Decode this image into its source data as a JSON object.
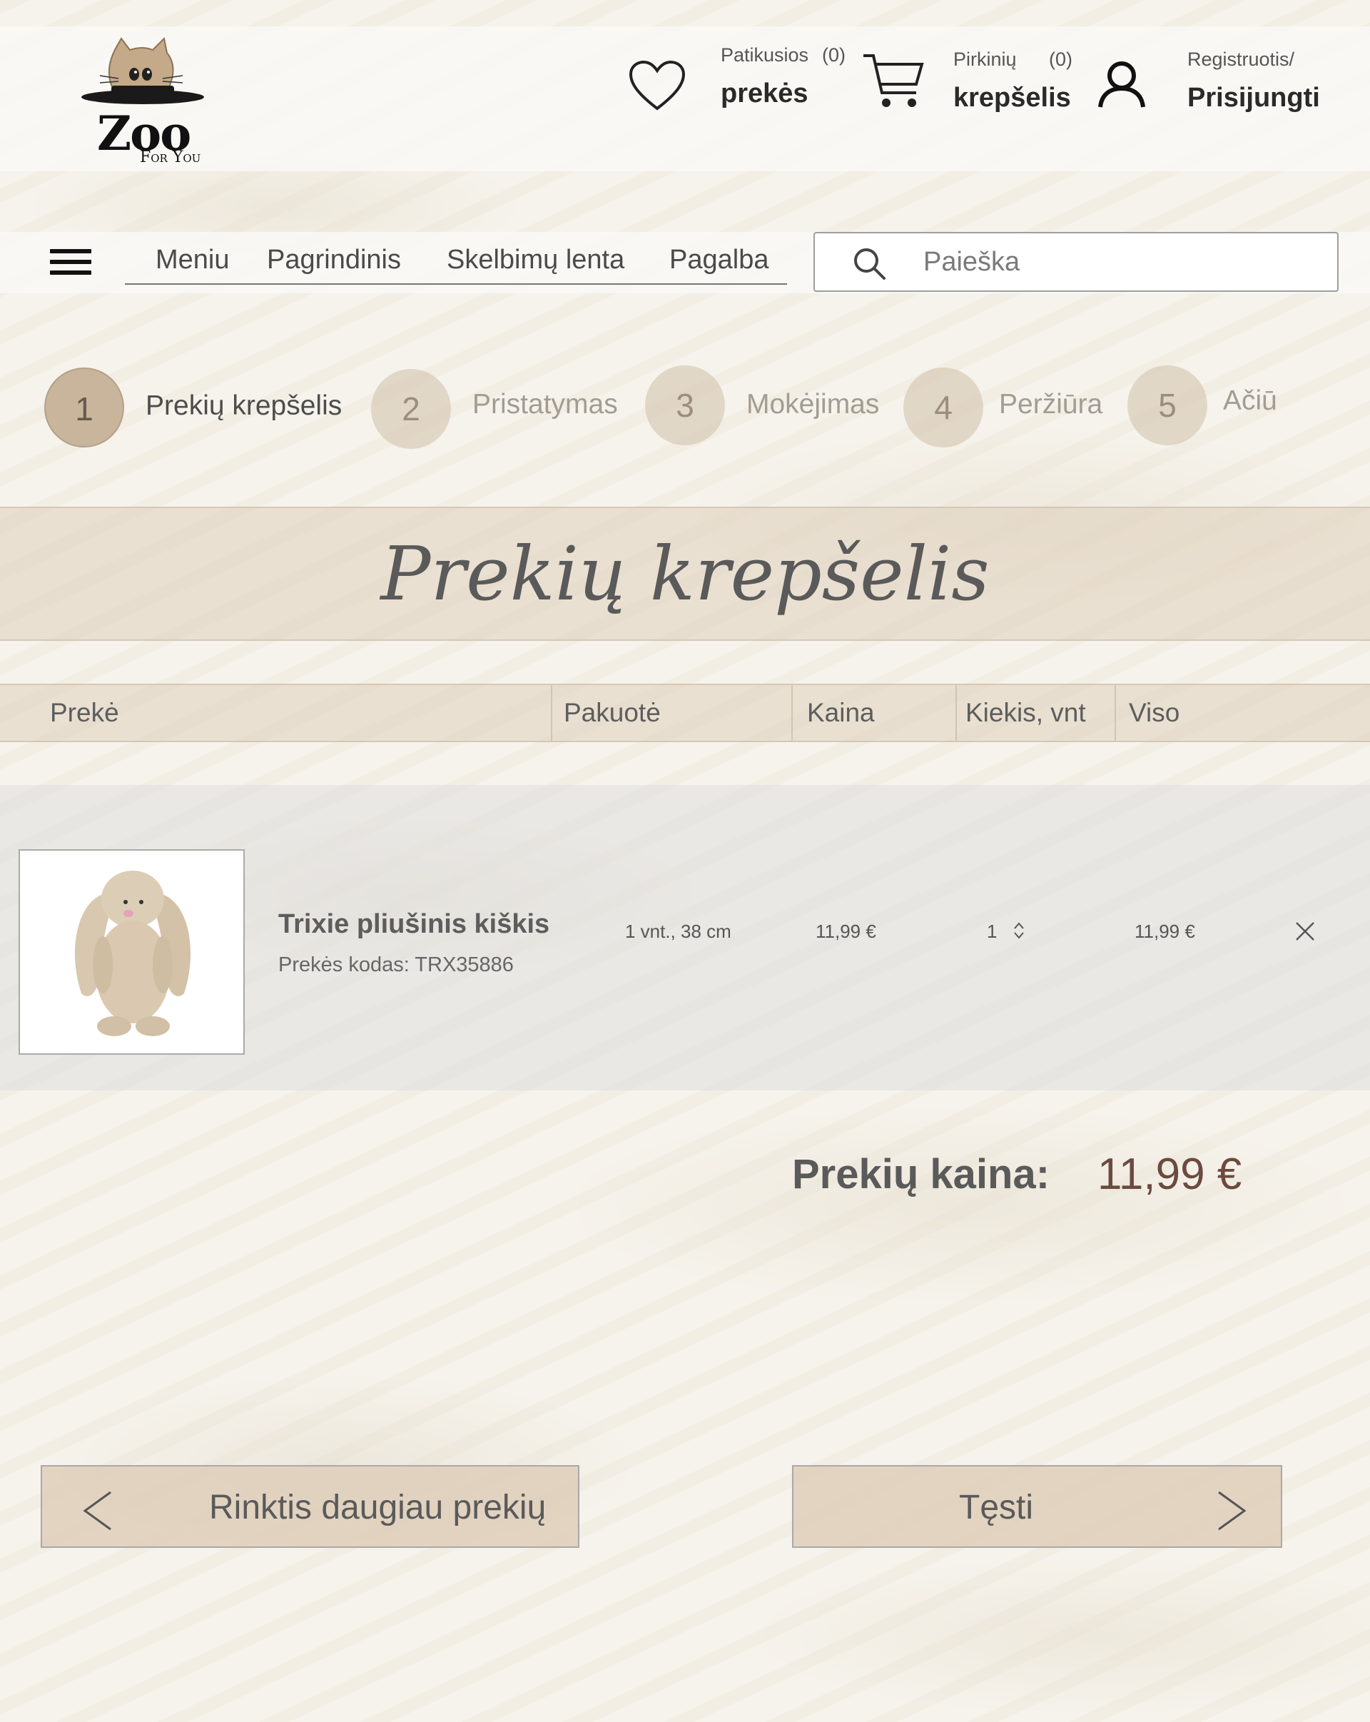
{
  "header": {
    "logo_text": "Zoo",
    "logo_sub": "For You",
    "favorites": {
      "label_top": "Patikusios",
      "count": "(0)",
      "label_bottom": "prekės"
    },
    "cart": {
      "label_top": "Pirkinių",
      "count": "(0)",
      "label_bottom": "krepšelis"
    },
    "account": {
      "label_top": "Registruotis/",
      "label_bottom": "Prisijungti"
    }
  },
  "nav": {
    "items": [
      "Meniu",
      "Pagrindinis",
      "Skelbimų lenta",
      "Pagalba"
    ],
    "search_placeholder": "Paieška"
  },
  "steps": [
    {
      "number": "1",
      "label": "Prekių krepšelis",
      "state": "active"
    },
    {
      "number": "2",
      "label": "Pristatymas",
      "state": "inactive"
    },
    {
      "number": "3",
      "label": "Mokėjimas",
      "state": "inactive"
    },
    {
      "number": "4",
      "label": "Peržiūra",
      "state": "inactive"
    },
    {
      "number": "5",
      "label": "Ačiū",
      "state": "inactive"
    }
  ],
  "page_title": "Prekių krepšelis",
  "table": {
    "columns": [
      "Prekė",
      "Pakuotė",
      "Kaina",
      "Kiekis, vnt",
      "Viso"
    ],
    "rows": [
      {
        "name": "Trixie pliušinis kiškis",
        "code": "Prekės kodas: TRX35886",
        "package": "1 vnt., 38 cm",
        "price": "11,99 €",
        "quantity": "1",
        "total": "11,99 €"
      }
    ]
  },
  "summary": {
    "label": "Prekių kaina:",
    "value": "11,99 €"
  },
  "buttons": {
    "back": "Rinktis daugiau prekių",
    "continue": "Tęsti"
  },
  "colors": {
    "accent": "#c8b59b",
    "price": "#6b4a40",
    "band": "#ded0bc"
  }
}
